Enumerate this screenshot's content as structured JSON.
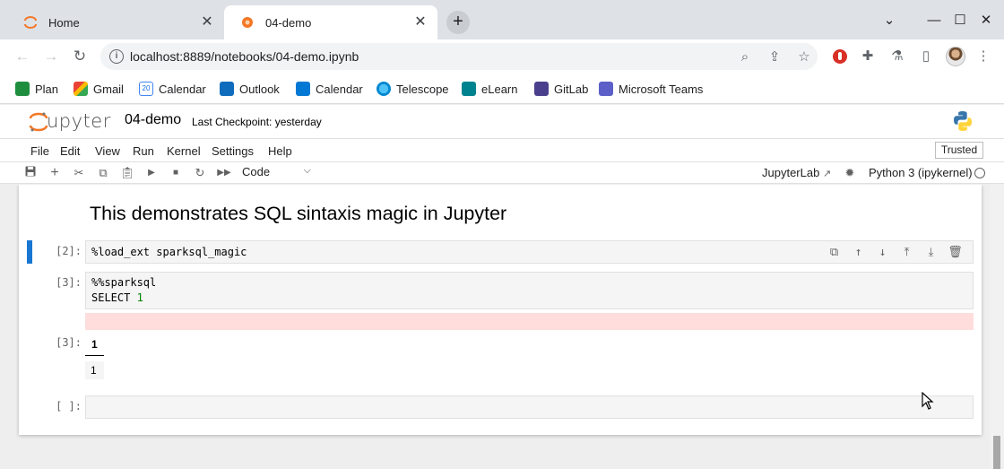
{
  "browser": {
    "tabs": [
      {
        "title": "Home",
        "active": false
      },
      {
        "title": "04-demo",
        "active": true
      }
    ],
    "url": "localhost:8889/notebooks/04-demo.ipynb",
    "bookmarks": [
      "Plan",
      "Gmail",
      "Calendar",
      "Outlook",
      "Calendar",
      "Telescope",
      "eLearn",
      "GitLab",
      "Microsoft Teams"
    ],
    "calendar_badge": "20"
  },
  "jupyter": {
    "logo_text": "Jupyter",
    "notebook_name": "04-demo",
    "checkpoint": "Last Checkpoint: yesterday",
    "menu": [
      "File",
      "Edit",
      "View",
      "Run",
      "Kernel",
      "Settings",
      "Help"
    ],
    "trusted": "Trusted",
    "cell_type": "Code",
    "jupyterlab_link": "JupyterLab",
    "kernel": "Python 3 (ipykernel)"
  },
  "notebook": {
    "heading": "This demonstrates SQL sintaxis magic in Jupyter",
    "cells": [
      {
        "prompt": "[2]:",
        "lines": [
          "%load_ext sparksql_magic"
        ]
      },
      {
        "prompt": "[3]:",
        "line1": "%%sparksql",
        "line2_kw": "SELECT ",
        "line2_num": "1"
      },
      {
        "prompt": "[3]:",
        "output_header": "1",
        "output_value": "1"
      },
      {
        "prompt": "[ ]:"
      }
    ]
  },
  "colors": {
    "accent": "#1976d2",
    "error_bg": "#ffdddd",
    "jupyter_orange": "#f37726"
  }
}
